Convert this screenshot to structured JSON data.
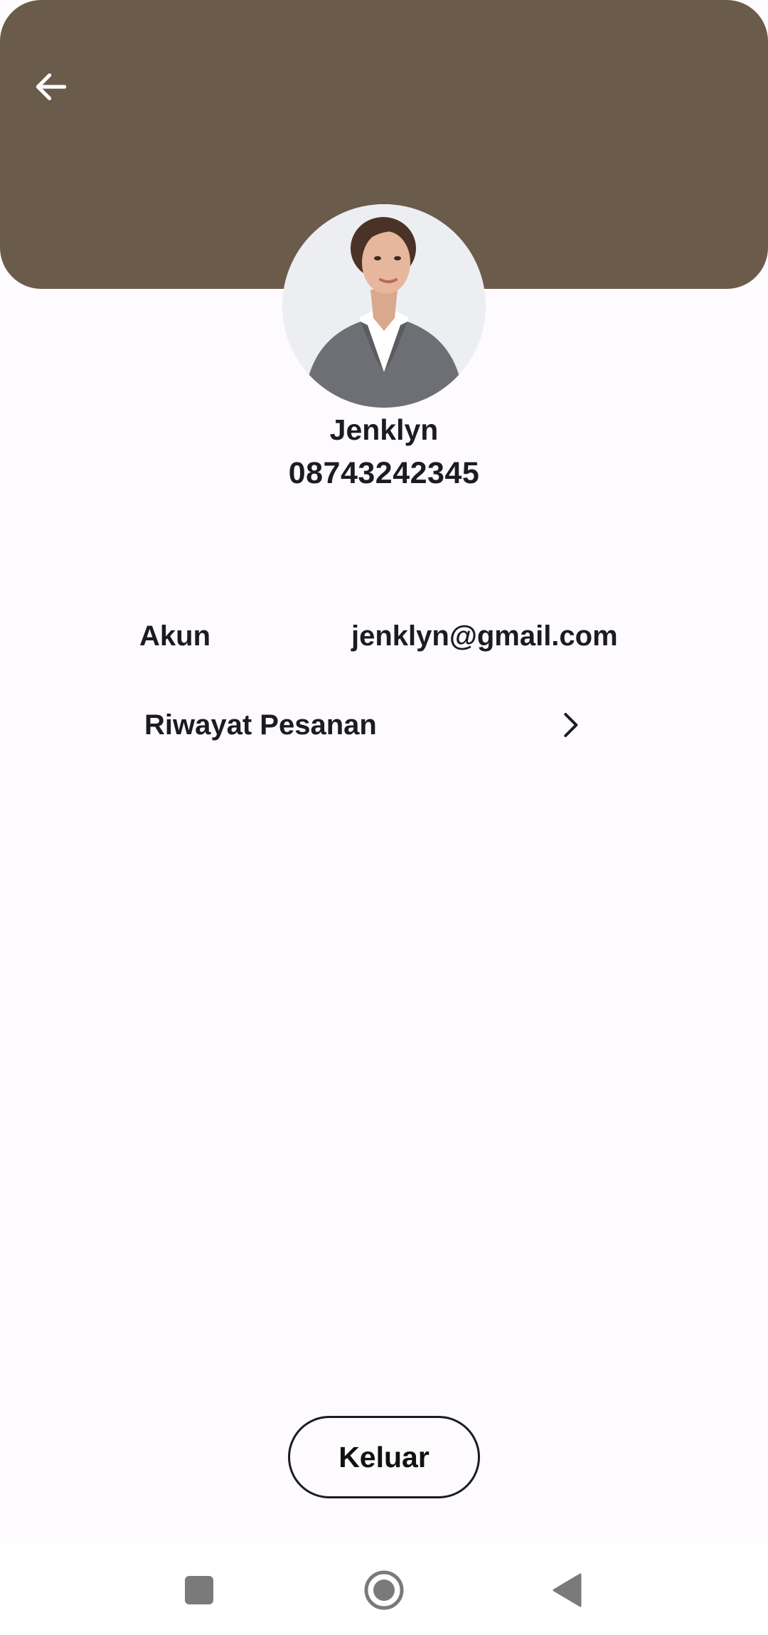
{
  "header": {
    "back_icon": "arrow-left-icon",
    "background_color": "#6a5b4b"
  },
  "profile": {
    "name": "Jenklyn",
    "phone": "08743242345"
  },
  "account": {
    "label": "Akun",
    "email": "jenklyn@gmail.com"
  },
  "order_history": {
    "label": "Riwayat Pesanan",
    "icon": "chevron-right-icon"
  },
  "logout": {
    "label": "Keluar"
  },
  "system_nav": {
    "items": [
      "recents-square-icon",
      "home-circle-icon",
      "back-triangle-icon"
    ]
  }
}
